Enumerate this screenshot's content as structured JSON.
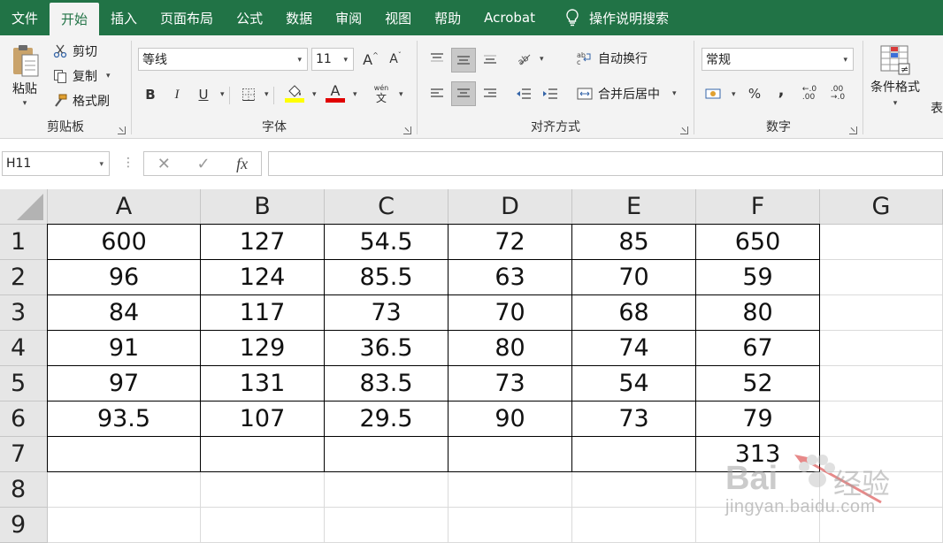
{
  "menu": {
    "tabs": [
      "文件",
      "开始",
      "插入",
      "页面布局",
      "公式",
      "数据",
      "审阅",
      "视图",
      "帮助",
      "Acrobat"
    ],
    "active_index": 1,
    "search_label": "操作说明搜索",
    "accent_color": "#217346"
  },
  "ribbon": {
    "clipboard": {
      "paste_label": "粘贴",
      "cut_label": "剪切",
      "copy_label": "复制",
      "format_painter_label": "格式刷",
      "group_label": "剪贴板"
    },
    "font": {
      "font_name": "等线",
      "font_size": "11",
      "grow_label": "A",
      "shrink_label": "A",
      "bold_label": "B",
      "italic_label": "I",
      "underline_label": "U",
      "font_color_label": "A",
      "phonetic_label": "文",
      "group_label": "字体",
      "fill_color": "#ffff00",
      "font_color": "#e00000"
    },
    "alignment": {
      "wrap_text_label": "自动换行",
      "merge_center_label": "合并后居中",
      "group_label": "对齐方式"
    },
    "number": {
      "format_value": "常规",
      "percent_label": "%",
      "comma_label": ",",
      "group_label": "数字"
    },
    "styles": {
      "conditional_format_label": "条件格式",
      "next_label_fragment": "表"
    }
  },
  "formula_bar": {
    "name_box_value": "H11",
    "fx_label": "fx",
    "formula_value": ""
  },
  "sheet": {
    "columns": [
      "A",
      "B",
      "C",
      "D",
      "E",
      "F",
      "G"
    ],
    "rows": [
      "1",
      "2",
      "3",
      "4",
      "5",
      "6",
      "7",
      "8",
      "9"
    ],
    "cells": [
      [
        "600",
        "127",
        "54.5",
        "72",
        "85",
        "650",
        ""
      ],
      [
        "96",
        "124",
        "85.5",
        "63",
        "70",
        "59",
        ""
      ],
      [
        "84",
        "117",
        "73",
        "70",
        "68",
        "80",
        ""
      ],
      [
        "91",
        "129",
        "36.5",
        "80",
        "74",
        "67",
        ""
      ],
      [
        "97",
        "131",
        "83.5",
        "73",
        "54",
        "52",
        ""
      ],
      [
        "93.5",
        "107",
        "29.5",
        "90",
        "73",
        "79",
        ""
      ],
      [
        "",
        "",
        "",
        "",
        "",
        "313",
        ""
      ],
      [
        "",
        "",
        "",
        "",
        "",
        "",
        ""
      ],
      [
        "",
        "",
        "",
        "",
        "",
        "",
        ""
      ]
    ]
  },
  "watermark": {
    "brand": "Bai",
    "brand_suffix": "经验",
    "url": "jingyan.baidu.com"
  }
}
